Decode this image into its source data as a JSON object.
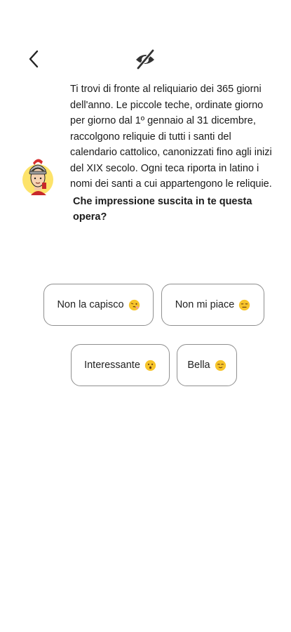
{
  "header": {
    "back_icon": "chevron-left-icon",
    "visibility_icon": "eye-off-icon"
  },
  "guide": {
    "avatar_icon": "roman-soldier-avatar"
  },
  "message": {
    "body": "Ti trovi di fronte al reliquiario dei 365 giorni dell'anno. Le piccole teche, ordinate giorno per giorno dal 1º gennaio al 31 dicembre, raccolgono reliquie di tutti i santi del calendario cattolico, canonizzati fino agli inizi del XIX secolo. Ogni teca riporta in latino i nomi dei santi a cui appartengono le reliquie.",
    "question": "Che impressione suscita in te questa opera?"
  },
  "options": [
    {
      "label": "Non la capisco",
      "emoji": "confused-face"
    },
    {
      "label": "Non mi piace",
      "emoji": "unamused-face"
    },
    {
      "label": "Interessante",
      "emoji": "surprised-face"
    },
    {
      "label": "Bella",
      "emoji": "relieved-face"
    }
  ],
  "colors": {
    "border": "#8f8f8f",
    "text": "#1a1a1a",
    "emoji_yellow": "#f7c52b"
  }
}
